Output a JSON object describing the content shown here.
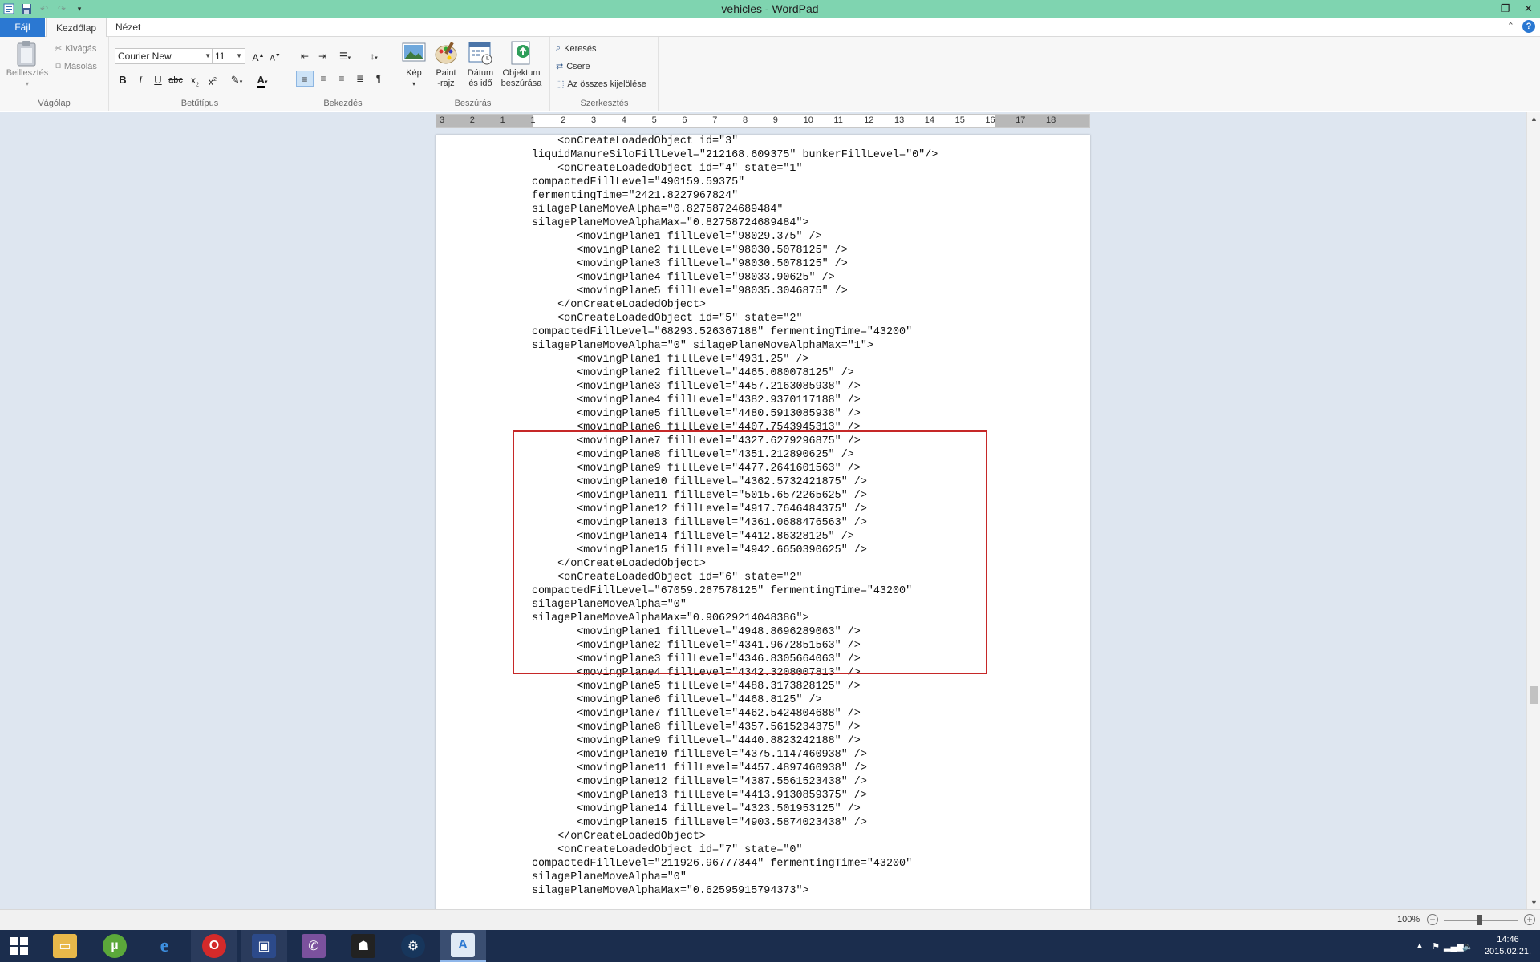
{
  "window": {
    "title": "vehicles - WordPad"
  },
  "tabs": {
    "file": "Fájl",
    "home": "Kezdőlap",
    "view": "Nézet"
  },
  "ribbon": {
    "clipboard": {
      "label": "Vágólap",
      "paste": "Beillesztés",
      "cut": "Kivágás",
      "copy": "Másolás"
    },
    "font": {
      "label": "Betűtípus",
      "family": "Courier New",
      "size": "11"
    },
    "paragraph": {
      "label": "Bekezdés"
    },
    "insert": {
      "label": "Beszúrás",
      "picture": "Kép",
      "paint_line1": "Paint",
      "paint_line2": "-rajz",
      "datetime_line1": "Dátum",
      "datetime_line2": "és idő",
      "object_line1": "Objektum",
      "object_line2": "beszúrása"
    },
    "editing": {
      "label": "Szerkesztés",
      "find": "Keresés",
      "replace": "Csere",
      "select_all": "Az összes kijelölése"
    }
  },
  "ruler": {
    "marks": [
      "3",
      "2",
      "1",
      "1",
      "2",
      "3",
      "4",
      "5",
      "6",
      "7",
      "8",
      "9",
      "10",
      "11",
      "12",
      "13",
      "14",
      "15",
      "16",
      "17",
      "18"
    ]
  },
  "document": {
    "lines": [
      "    <onCreateLoadedObject id=\"3\"",
      "liquidManureSiloFillLevel=\"212168.609375\" bunkerFillLevel=\"0\"/>",
      "    <onCreateLoadedObject id=\"4\" state=\"1\"",
      "compactedFillLevel=\"490159.59375\"",
      "fermentingTime=\"2421.8227967824\"",
      "silagePlaneMoveAlpha=\"0.82758724689484\"",
      "silagePlaneMoveAlphaMax=\"0.82758724689484\">",
      "       <movingPlane1 fillLevel=\"98029.375\" />",
      "       <movingPlane2 fillLevel=\"98030.5078125\" />",
      "       <movingPlane3 fillLevel=\"98030.5078125\" />",
      "       <movingPlane4 fillLevel=\"98033.90625\" />",
      "       <movingPlane5 fillLevel=\"98035.3046875\" />",
      "    </onCreateLoadedObject>",
      "    <onCreateLoadedObject id=\"5\" state=\"2\"",
      "compactedFillLevel=\"68293.526367188\" fermentingTime=\"43200\"",
      "silagePlaneMoveAlpha=\"0\" silagePlaneMoveAlphaMax=\"1\">",
      "       <movingPlane1 fillLevel=\"4931.25\" />",
      "       <movingPlane2 fillLevel=\"4465.080078125\" />",
      "       <movingPlane3 fillLevel=\"4457.2163085938\" />",
      "       <movingPlane4 fillLevel=\"4382.9370117188\" />",
      "       <movingPlane5 fillLevel=\"4480.5913085938\" />",
      "       <movingPlane6 fillLevel=\"4407.7543945313\" />",
      "       <movingPlane7 fillLevel=\"4327.6279296875\" />",
      "       <movingPlane8 fillLevel=\"4351.212890625\" />",
      "       <movingPlane9 fillLevel=\"4477.2641601563\" />",
      "       <movingPlane10 fillLevel=\"4362.5732421875\" />",
      "       <movingPlane11 fillLevel=\"5015.6572265625\" />",
      "       <movingPlane12 fillLevel=\"4917.7646484375\" />",
      "       <movingPlane13 fillLevel=\"4361.0688476563\" />",
      "       <movingPlane14 fillLevel=\"4412.86328125\" />",
      "       <movingPlane15 fillLevel=\"4942.6650390625\" />",
      "    </onCreateLoadedObject>",
      "    <onCreateLoadedObject id=\"6\" state=\"2\"",
      "compactedFillLevel=\"67059.267578125\" fermentingTime=\"43200\"",
      "silagePlaneMoveAlpha=\"0\"",
      "silagePlaneMoveAlphaMax=\"0.90629214048386\">",
      "       <movingPlane1 fillLevel=\"4948.8696289063\" />",
      "       <movingPlane2 fillLevel=\"4341.9672851563\" />",
      "       <movingPlane3 fillLevel=\"4346.8305664063\" />",
      "       <movingPlane4 fillLevel=\"4342.3208007813\" />",
      "       <movingPlane5 fillLevel=\"4488.3173828125\" />",
      "       <movingPlane6 fillLevel=\"4468.8125\" />",
      "       <movingPlane7 fillLevel=\"4462.5424804688\" />",
      "       <movingPlane8 fillLevel=\"4357.5615234375\" />",
      "       <movingPlane9 fillLevel=\"4440.8823242188\" />",
      "       <movingPlane10 fillLevel=\"4375.1147460938\" />",
      "       <movingPlane11 fillLevel=\"4457.4897460938\" />",
      "       <movingPlane12 fillLevel=\"4387.5561523438\" />",
      "       <movingPlane13 fillLevel=\"4413.9130859375\" />",
      "       <movingPlane14 fillLevel=\"4323.501953125\" />",
      "       <movingPlane15 fillLevel=\"4903.5874023438\" />",
      "    </onCreateLoadedObject>",
      "    <onCreateLoadedObject id=\"7\" state=\"0\"",
      "compactedFillLevel=\"211926.96777344\" fermentingTime=\"43200\"",
      "silagePlaneMoveAlpha=\"0\"",
      "silagePlaneMoveAlphaMax=\"0.62595915794373\">"
    ]
  },
  "statusbar": {
    "zoom": "100%"
  },
  "taskbar": {
    "clock_time": "14:46",
    "clock_date": "2015.02.21."
  },
  "colors": {
    "titlebar": "#7fd4b0",
    "file_tab": "#2b78d2",
    "highlight_box": "#c62828",
    "taskbar": "#1b2d4d"
  }
}
